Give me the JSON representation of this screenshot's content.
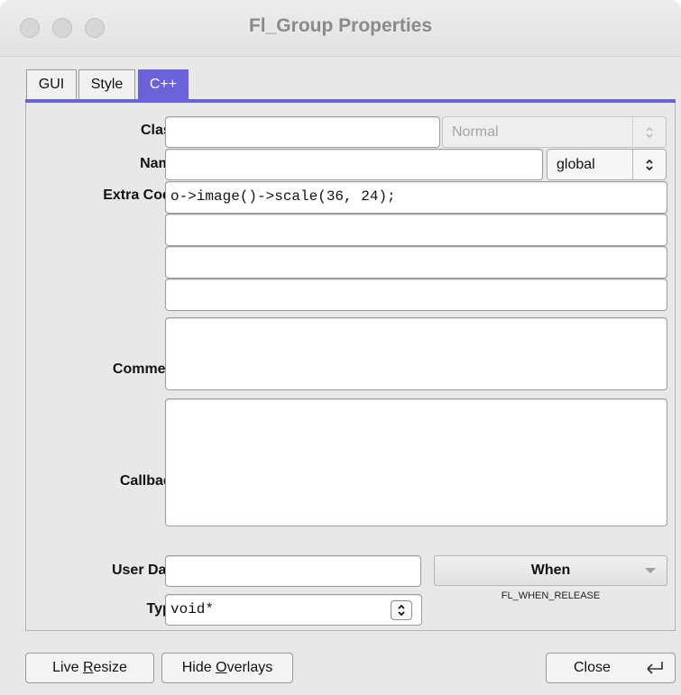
{
  "window": {
    "title": "Fl_Group Properties"
  },
  "tabs": [
    {
      "label": "GUI",
      "active": false
    },
    {
      "label": "Style",
      "active": false
    },
    {
      "label": "C++",
      "active": true
    }
  ],
  "fields": {
    "class": {
      "label": "Class:",
      "value": "",
      "mode_value": "Normal"
    },
    "name": {
      "label": "Name:",
      "value": "",
      "scope_value": "global"
    },
    "extra_code": {
      "label": "Extra Code:",
      "lines": [
        "o->image()->scale(36, 24);",
        "",
        "",
        ""
      ]
    },
    "comment": {
      "label": "Comment:",
      "value": ""
    },
    "callback": {
      "label": "Callback:",
      "value": ""
    },
    "user_data": {
      "label": "User Data:",
      "value": ""
    },
    "when": {
      "label": "When",
      "value": "FL_WHEN_RELEASE"
    },
    "type": {
      "label": "Type:",
      "value": "void*"
    }
  },
  "footer": {
    "live_resize": {
      "prefix": "Live ",
      "accel": "R",
      "suffix": "esize"
    },
    "hide_overlays": {
      "prefix": "Hide ",
      "accel": "O",
      "suffix": "verlays"
    },
    "close": "Close"
  },
  "colors": {
    "accent": "#6a62d6",
    "background": "#e8e8e8"
  }
}
